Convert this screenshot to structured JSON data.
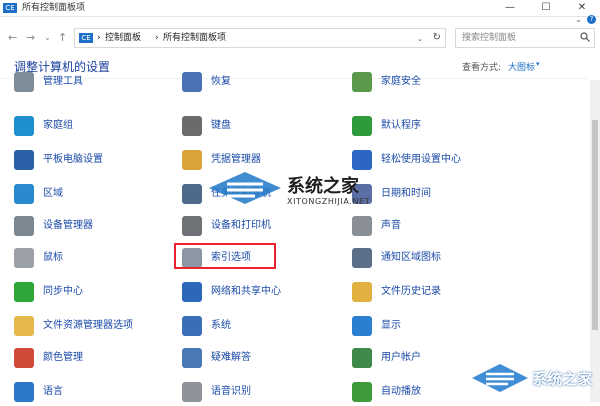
{
  "window": {
    "title": "所有控制面板项",
    "app_icon_text": "CE",
    "min_glyph": "—",
    "max_glyph": "☐",
    "close_glyph": "✕",
    "help_arrow": "⌄",
    "help_q": "?"
  },
  "nav": {
    "back": "←",
    "forward": "→",
    "recent": "⌄",
    "up": "↑",
    "address_parts": [
      "控制面板",
      "所有控制面板项"
    ],
    "sep": "›",
    "refresh": "↻",
    "drop": "⌄",
    "search_placeholder": "搜索控制面板"
  },
  "header": {
    "heading": "调整计算机的设置",
    "view_by_label": "查看方式:",
    "view_by_value": "大图标",
    "caret": "▾"
  },
  "items": [
    {
      "label": "管理工具",
      "color": "#7d8d9a"
    },
    {
      "label": "恢复",
      "color": "#4a73b5"
    },
    {
      "label": "家庭安全",
      "color": "#5b9a4c"
    },
    {
      "label": "家庭组",
      "color": "#1f8fd0"
    },
    {
      "label": "键盘",
      "color": "#6b6b6b"
    },
    {
      "label": "默认程序",
      "color": "#2f9a3c"
    },
    {
      "label": "平板电脑设置",
      "color": "#2b5fa8"
    },
    {
      "label": "凭据管理器",
      "color": "#d9a23a"
    },
    {
      "label": "轻松使用设置中心",
      "color": "#2b66c5"
    },
    {
      "label": "区域",
      "color": "#2a8ad0"
    },
    {
      "label": "任务栏和导航",
      "color": "#4d6a8a"
    },
    {
      "label": "日期和时间",
      "color": "#5a6fa3"
    },
    {
      "label": "设备管理器",
      "color": "#7c8891"
    },
    {
      "label": "设备和打印机",
      "color": "#6f7378"
    },
    {
      "label": "声音",
      "color": "#8a8f96"
    },
    {
      "label": "鼠标",
      "color": "#9aa0a6"
    },
    {
      "label": "索引选项",
      "color": "#8c97a5"
    },
    {
      "label": "通知区域图标",
      "color": "#5c6f88"
    },
    {
      "label": "同步中心",
      "color": "#30a63a"
    },
    {
      "label": "网络和共享中心",
      "color": "#2c67b8"
    },
    {
      "label": "文件历史记录",
      "color": "#e0b040"
    },
    {
      "label": "文件资源管理器选项",
      "color": "#e4b84a"
    },
    {
      "label": "系统",
      "color": "#3a6fb8"
    },
    {
      "label": "显示",
      "color": "#2b7ed1"
    },
    {
      "label": "颜色管理",
      "color": "#d04a3a"
    },
    {
      "label": "疑难解答",
      "color": "#4a79b5"
    },
    {
      "label": "用户帐户",
      "color": "#3f8a4a"
    },
    {
      "label": "语言",
      "color": "#2b77c8"
    },
    {
      "label": "语音识别",
      "color": "#8d9399"
    },
    {
      "label": "自动播放",
      "color": "#3f9a3c"
    }
  ],
  "watermarks": {
    "center_text": "系统之家",
    "center_sub": "XITONGZHIJIA.NET",
    "corner_text": "系统之家"
  }
}
